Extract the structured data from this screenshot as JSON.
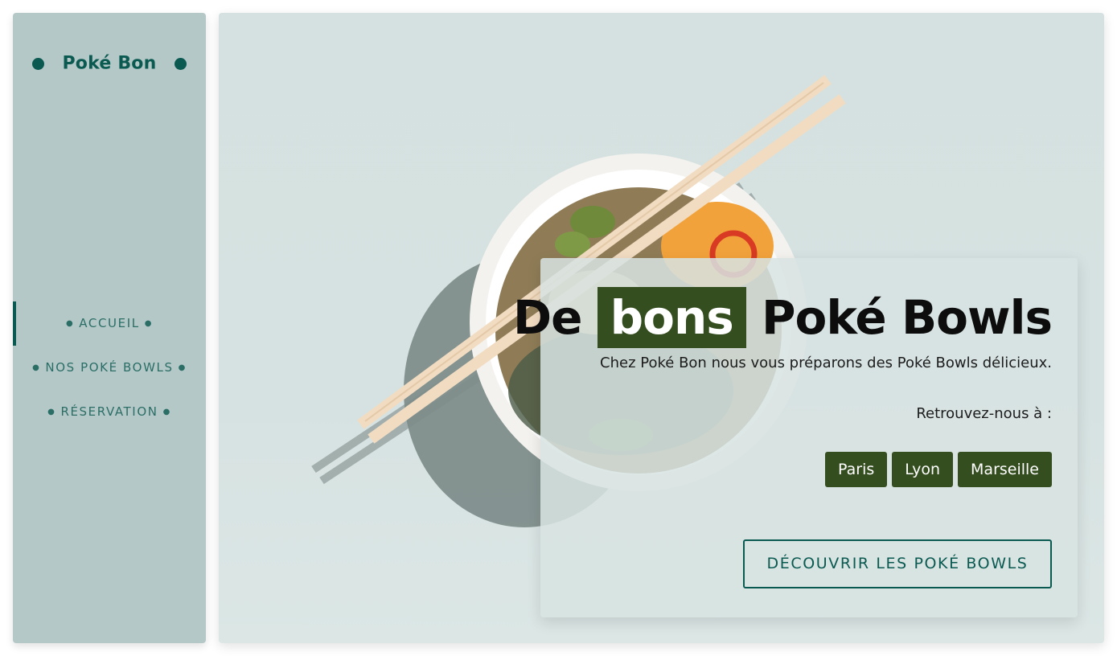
{
  "brand": {
    "name": "Poké Bon"
  },
  "nav": {
    "items": [
      {
        "label": "ACCUEIL",
        "active": true
      },
      {
        "label": "NOS POKÉ BOWLS",
        "active": false
      },
      {
        "label": "RÉSERVATION",
        "active": false
      }
    ]
  },
  "hero": {
    "headline_before": "De",
    "headline_highlight": "bons",
    "headline_after": "Poké Bowls",
    "subtitle": "Chez Poké Bon nous vous préparons des Poké Bowls délicieux.",
    "find_us": "Retrouvez-nous à :",
    "cities": [
      "Paris",
      "Lyon",
      "Marseille"
    ],
    "cta_label": "DÉCOUVRIR LES POKÉ BOWLS"
  },
  "colors": {
    "brand_green": "#0b5a52",
    "sidebar_bg": "#b5c8c8",
    "highlight_bg": "#344e1f",
    "hero_bg": "#d6e2e1"
  }
}
